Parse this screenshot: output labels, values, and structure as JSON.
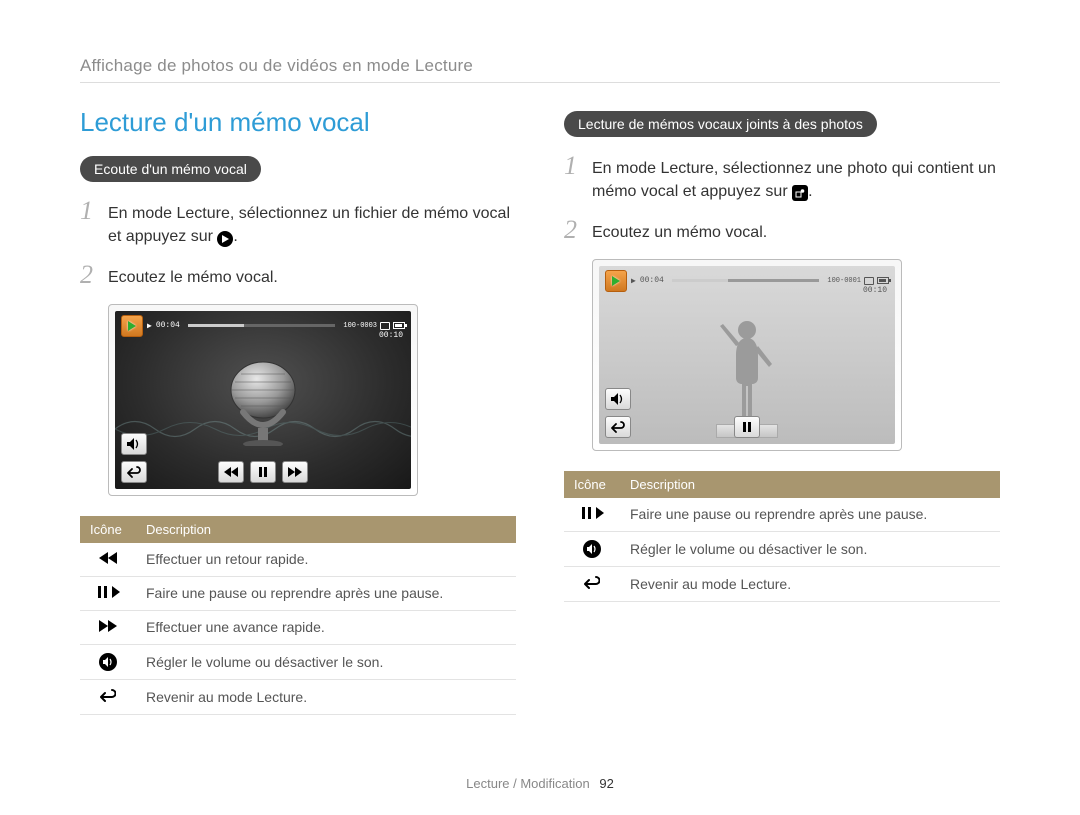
{
  "breadcrumb": "Affichage de photos ou de vidéos en mode Lecture",
  "title": "Lecture d'un mémo vocal",
  "left": {
    "pill": "Ecoute d'un mémo vocal",
    "step1": "En mode Lecture, sélectionnez un fichier de mémo vocal et appuyez sur ",
    "step2": "Ecoutez le mémo vocal.",
    "screen": {
      "elapsed": "00:04",
      "file": "100-0003",
      "total": "00:10"
    },
    "table_head_icon": "Icône",
    "table_head_desc": "Description",
    "rows": [
      {
        "icon": "rewind",
        "desc": "Effectuer un retour rapide."
      },
      {
        "icon": "pauseplay",
        "desc": "Faire une pause ou reprendre après une pause."
      },
      {
        "icon": "forward",
        "desc": "Effectuer une avance rapide."
      },
      {
        "icon": "volume",
        "desc": "Régler le volume ou désactiver le son."
      },
      {
        "icon": "back",
        "desc": "Revenir au mode Lecture."
      }
    ]
  },
  "right": {
    "pill": "Lecture de mémos vocaux joints à des photos",
    "step1": "En mode Lecture, sélectionnez une photo qui contient un mémo vocal et appuyez sur ",
    "step2": "Ecoutez un mémo vocal.",
    "screen": {
      "elapsed": "00:04",
      "file": "100-0001",
      "total": "00:10"
    },
    "table_head_icon": "Icône",
    "table_head_desc": "Description",
    "rows": [
      {
        "icon": "pauseplay",
        "desc": "Faire une pause ou reprendre après une pause."
      },
      {
        "icon": "volume",
        "desc": "Régler le volume ou désactiver le son."
      },
      {
        "icon": "back",
        "desc": "Revenir au mode Lecture."
      }
    ]
  },
  "footer_section": "Lecture / Modification",
  "page_number": "92"
}
